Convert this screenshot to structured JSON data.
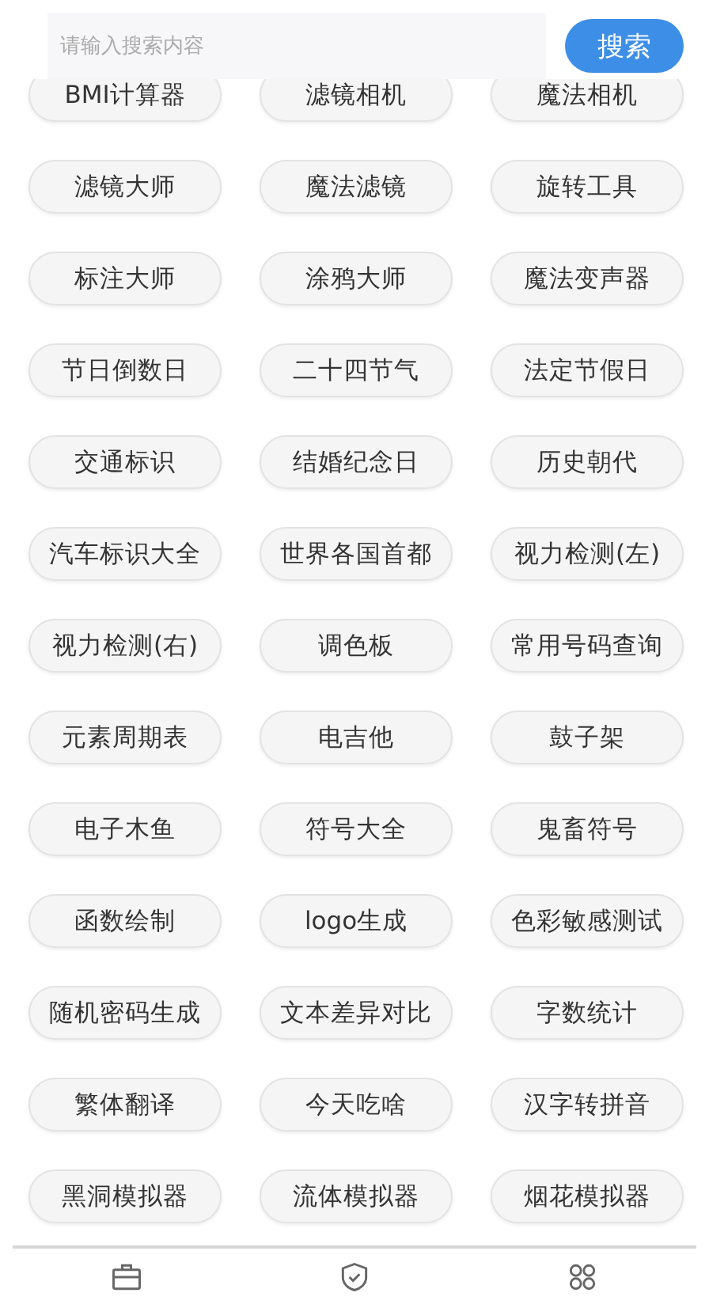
{
  "search": {
    "placeholder": "请输入搜索内容",
    "button": "搜索"
  },
  "tools": [
    "BMI计算器",
    "滤镜相机",
    "魔法相机",
    "滤镜大师",
    "魔法滤镜",
    "旋转工具",
    "标注大师",
    "涂鸦大师",
    "魔法变声器",
    "节日倒数日",
    "二十四节气",
    "法定节假日",
    "交通标识",
    "结婚纪念日",
    "历史朝代",
    "汽车标识大全",
    "世界各国首都",
    "视力检测(左)",
    "视力检测(右)",
    "调色板",
    "常用号码查询",
    "元素周期表",
    "电吉他",
    "鼓子架",
    "电子木鱼",
    "符号大全",
    "鬼畜符号",
    "函数绘制",
    "logo生成",
    "色彩敏感测试",
    "随机密码生成",
    "文本差异对比",
    "字数统计",
    "繁体翻译",
    "今天吃啥",
    "汉字转拼音",
    "黑洞模拟器",
    "流体模拟器",
    "烟花模拟器"
  ],
  "bottom_nav": [
    {
      "kind": "toolbox"
    },
    {
      "kind": "shield"
    },
    {
      "kind": "grid"
    }
  ]
}
